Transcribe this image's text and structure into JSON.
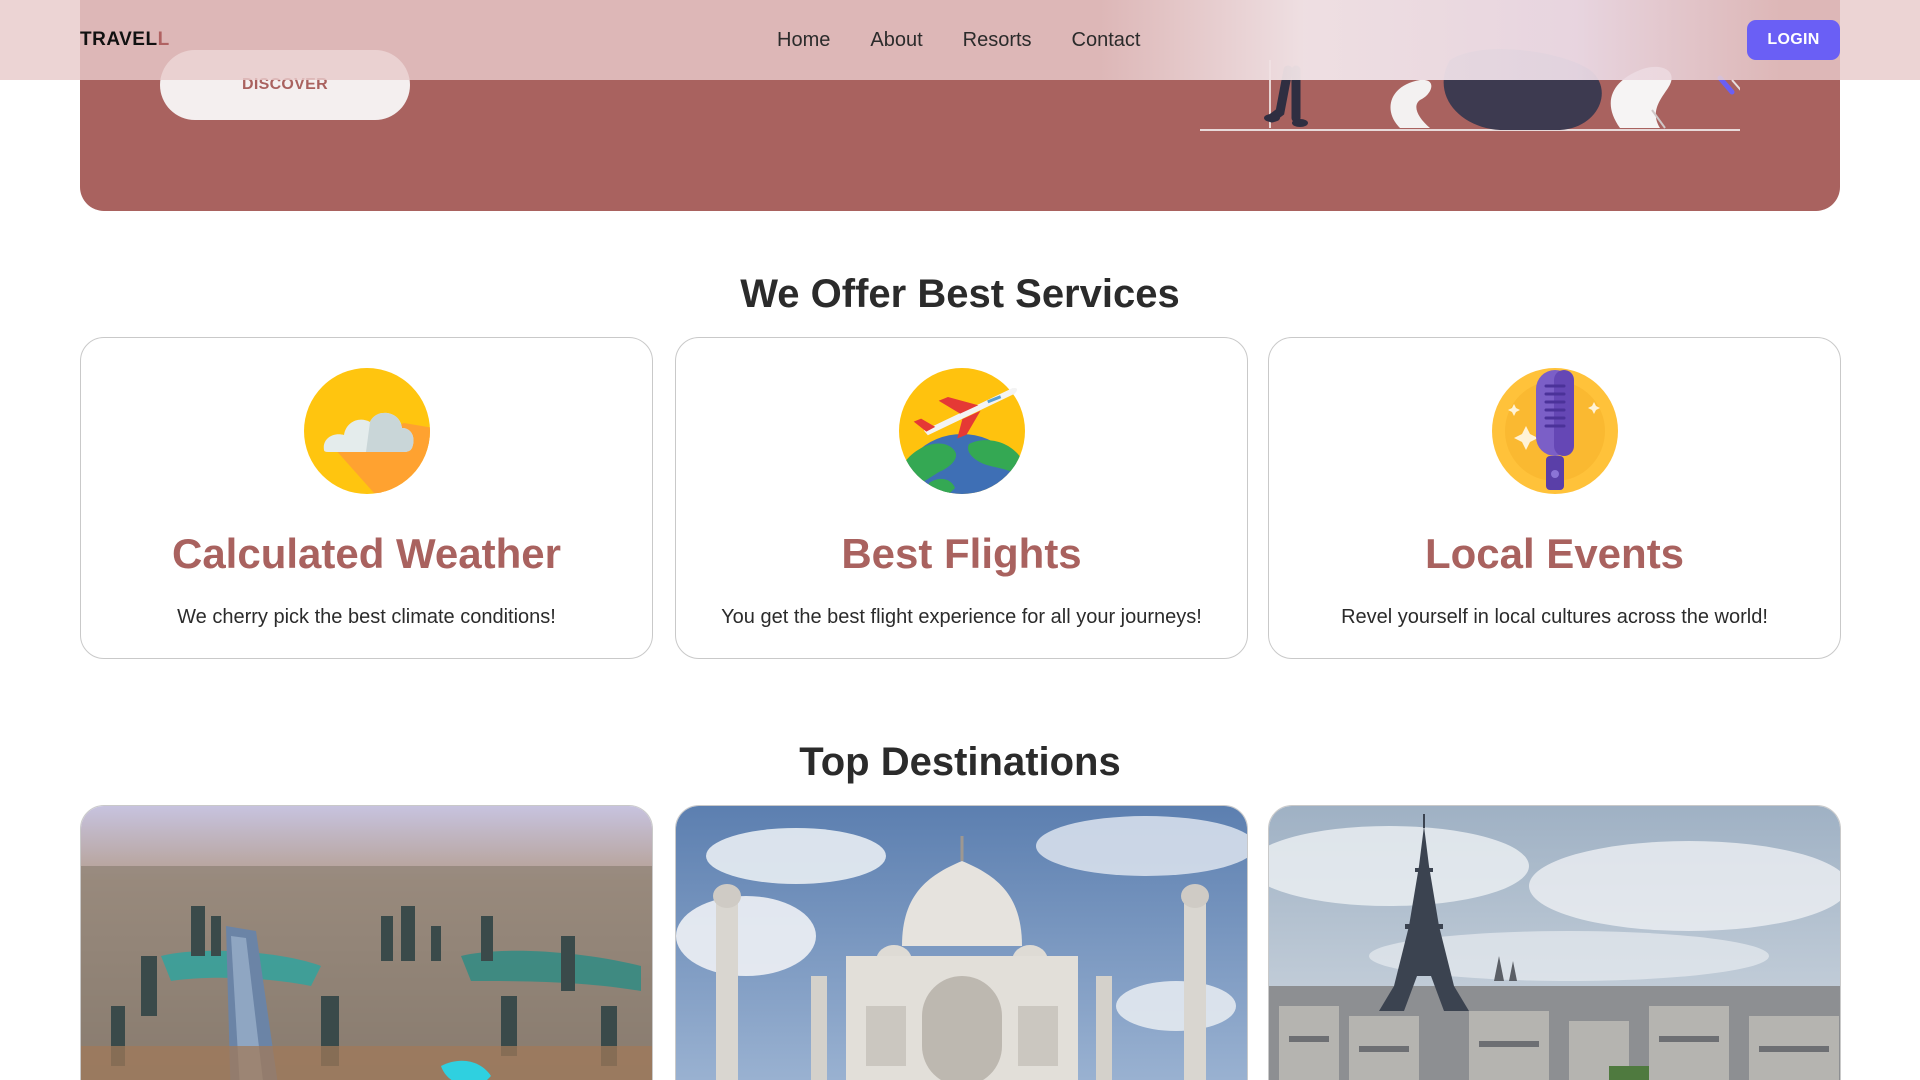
{
  "navbar": {
    "brand_main": "TRAVEL",
    "brand_accent": "L",
    "links": [
      "Home",
      "About",
      "Resorts",
      "Contact"
    ],
    "login_label": "LOGIN"
  },
  "hero": {
    "discover_label": "DISCOVER"
  },
  "services": {
    "title": "We Offer Best Services",
    "cards": [
      {
        "icon": "weather-cloud-icon",
        "title": "Calculated Weather",
        "text": "We cherry pick the best climate conditions!"
      },
      {
        "icon": "flight-globe-icon",
        "title": "Best Flights",
        "text": "You get the best flight experience for all your journeys!"
      },
      {
        "icon": "microphone-icon",
        "title": "Local Events",
        "text": "Revel yourself in local cultures across the world!"
      }
    ]
  },
  "destinations": {
    "title": "Top Destinations",
    "images": [
      "dubai-aerial-image",
      "taj-mahal-image",
      "paris-eiffel-image"
    ]
  },
  "colors": {
    "accent": "#a9625f",
    "login": "#6a5ff5",
    "text": "#2b2b2b"
  }
}
